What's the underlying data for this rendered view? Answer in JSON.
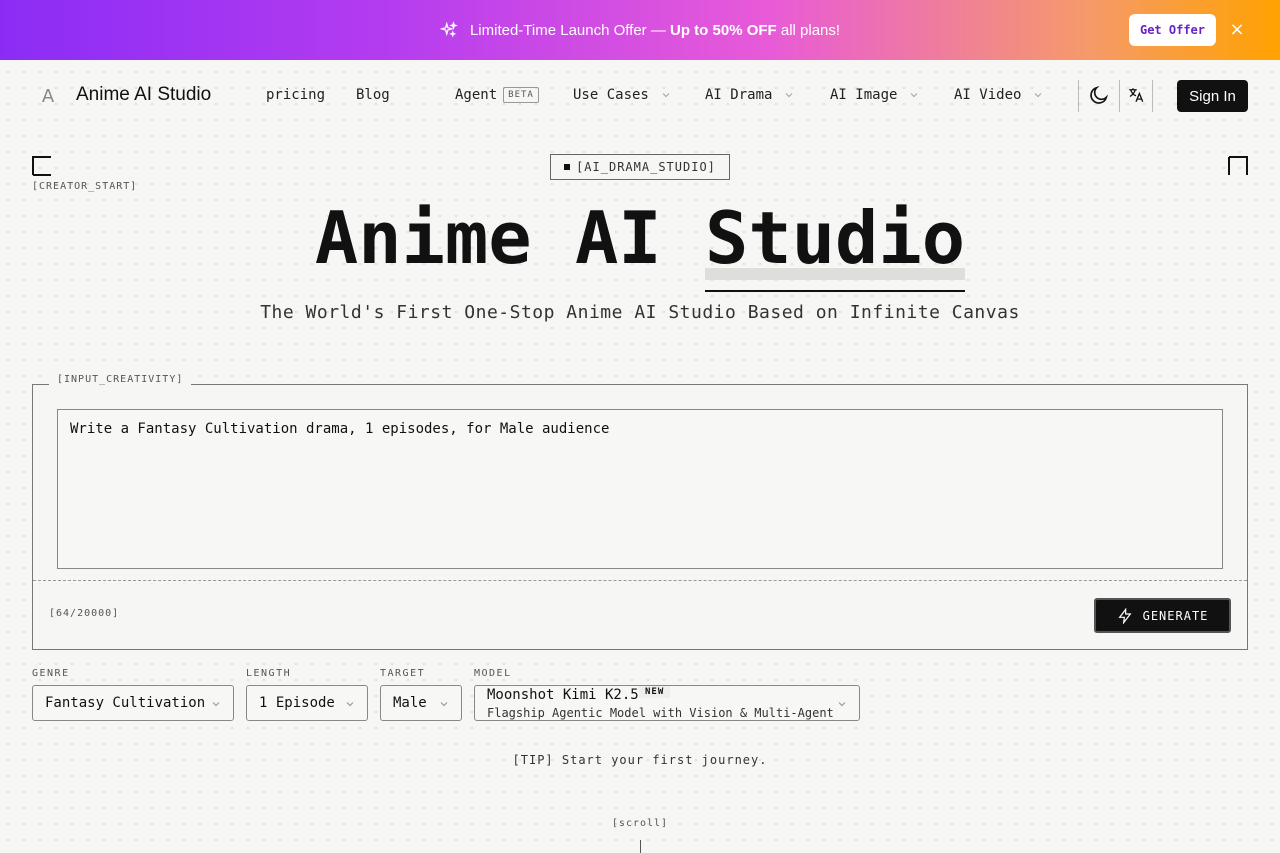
{
  "promo": {
    "prefix": "Limited-Time Launch Offer — ",
    "highlight": "Up to 50% OFF",
    "suffix": " all plans!",
    "cta": "Get Offer",
    "close": "×"
  },
  "header": {
    "brand": "Anime AI Studio",
    "logo_glyph": "A",
    "nav": {
      "pricing": "pricing",
      "blog": "Blog",
      "agent": "Agent",
      "agent_badge": "BETA",
      "use_cases": "Use Cases",
      "ai_drama": "AI Drama",
      "ai_image": "AI Image",
      "ai_video": "AI Video"
    },
    "sign_in": "Sign In"
  },
  "hero": {
    "corner_label": "[CREATOR_START]",
    "tag": "[AI_DRAMA_STUDIO]",
    "title_plain": "Anime AI ",
    "title_highlight": "Studio",
    "subtitle": "The World's First One-Stop Anime AI Studio Based on Infinite Canvas"
  },
  "input": {
    "legend": "[INPUT_CREATIVITY]",
    "prompt": "Write a Fantasy Cultivation drama, 1 episodes, for Male audience",
    "counter": "[64/20000]",
    "generate": "GENERATE"
  },
  "options": {
    "genre_label": "GENRE",
    "genre_value": "Fantasy Cultivation",
    "length_label": "LENGTH",
    "length_value": "1 Episode",
    "target_label": "TARGET",
    "target_value": "Male",
    "model_label": "MODEL",
    "model_name": "Moonshot Kimi K2.5",
    "model_badge": "NEW",
    "model_desc": "Flagship Agentic Model with Vision & Multi-Agent"
  },
  "tip": "[TIP] Start your first journey.",
  "scroll": "[scroll]",
  "colors": {
    "promo_gradient_start": "#8b2cf5",
    "promo_gradient_end": "#ffa200",
    "primary_button": "#111111",
    "background": "#f6f6f5"
  }
}
